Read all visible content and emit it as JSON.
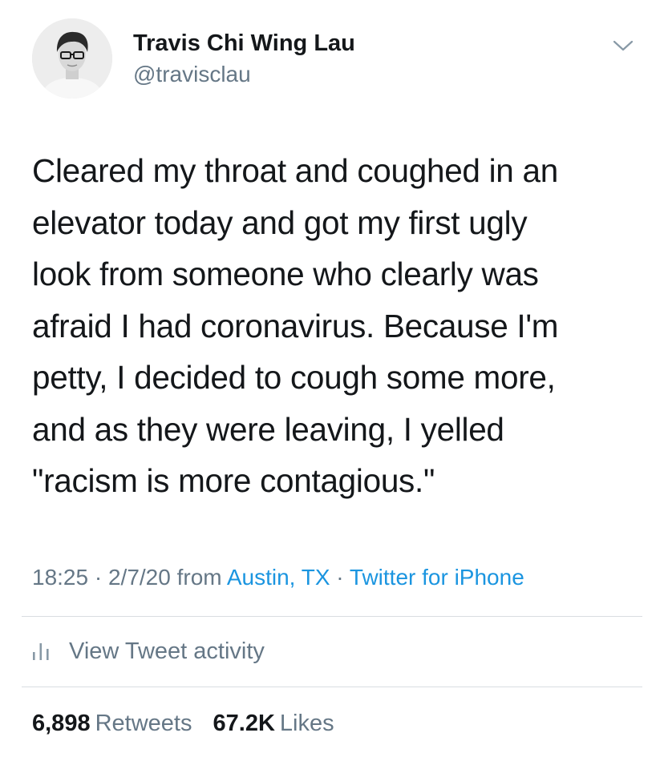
{
  "author": {
    "display_name": "Travis Chi Wing Lau",
    "handle": "@travisclau",
    "avatar_icon": "user-avatar-photo"
  },
  "tweet": {
    "lines": [
      "Cleared my throat and coughed in an",
      "elevator today and got my first ugly",
      "look from someone who clearly was",
      "afraid I had coronavirus. Because I'm",
      "petty, I decided to cough some more,",
      "and as they were leaving, I yelled",
      "\"racism is more contagious.\""
    ]
  },
  "meta": {
    "time": "18:25",
    "separator": "·",
    "date": "2/7/20",
    "from_label": "from",
    "location": "Austin, TX",
    "source": "Twitter for iPhone"
  },
  "activity": {
    "label": "View Tweet activity",
    "icon": "bar-chart-icon"
  },
  "stats": {
    "retweets_count": "6,898",
    "retweets_label": "Retweets",
    "likes_count": "67.2K",
    "likes_label": "Likes"
  },
  "colors": {
    "text": "#14171a",
    "secondary": "#657786",
    "link": "#1b95e0",
    "divider": "#d9dde1"
  }
}
